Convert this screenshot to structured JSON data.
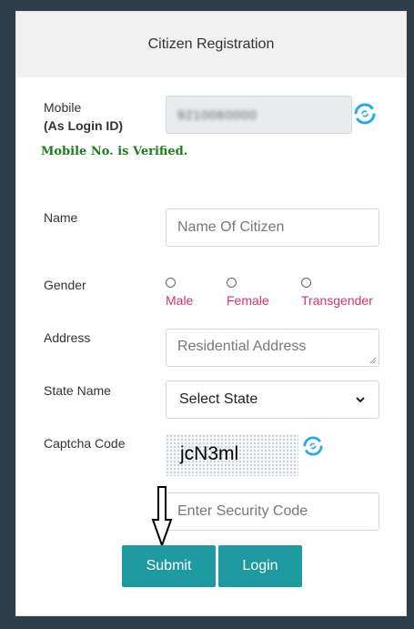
{
  "header": {
    "title": "Citizen Registration"
  },
  "mobile": {
    "label_line1": "Mobile",
    "label_line2": "(As Login ID)",
    "value": "9210060000",
    "verified_text": "Mobile No. is Verified."
  },
  "name": {
    "label": "Name",
    "placeholder": "Name Of Citizen"
  },
  "gender": {
    "label": "Gender",
    "options": [
      "Male",
      "Female",
      "Transgender"
    ]
  },
  "address": {
    "label": "Address",
    "placeholder": "Residential Address"
  },
  "state": {
    "label": "State Name",
    "selected": "Select State"
  },
  "captcha": {
    "label": "Captcha Code",
    "code": "jcN3ml",
    "input_placeholder": "Enter Security Code"
  },
  "buttons": {
    "submit": "Submit",
    "login": "Login"
  },
  "colors": {
    "button": "#1e9aa0",
    "gender_label": "#d6336c",
    "verified": "#1d7d1d",
    "refresh_icon": "#29a9e1",
    "background": "#2f3d4a"
  },
  "icons": [
    "refresh-icon",
    "captcha-refresh-icon",
    "dropdown-chevron-icon",
    "arrow-down-icon"
  ]
}
